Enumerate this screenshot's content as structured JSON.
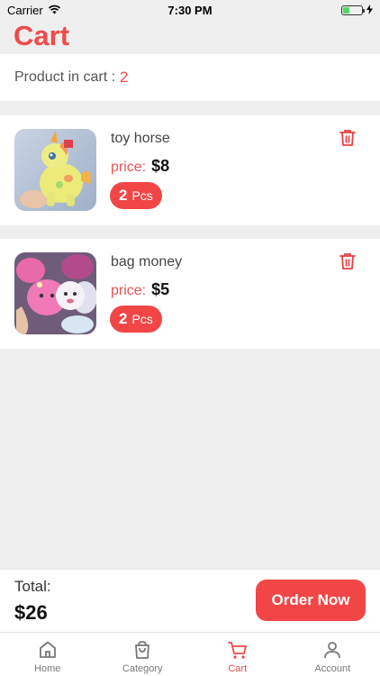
{
  "status_bar": {
    "carrier": "Carrier",
    "time": "7:30 PM",
    "battery_level": 0.35
  },
  "header": {
    "title": "Cart"
  },
  "cart_summary": {
    "label": "Product in cart :",
    "count": "2"
  },
  "items": [
    {
      "name": "toy horse",
      "price_label": "price:",
      "price": "$8",
      "qty": "2",
      "qty_unit": "Pcs",
      "image_icon": "toy-horse-photo"
    },
    {
      "name": "bag money",
      "price_label": "price:",
      "price": "$5",
      "qty": "2",
      "qty_unit": "Pcs",
      "image_icon": "bag-money-photo"
    }
  ],
  "footer": {
    "total_label": "Total:",
    "total_value": "$26",
    "order_button": "Order Now"
  },
  "tabs": [
    {
      "label": "Home",
      "icon": "home-icon",
      "active": false
    },
    {
      "label": "Category",
      "icon": "bag-icon",
      "active": false
    },
    {
      "label": "Cart",
      "icon": "cart-icon",
      "active": true
    },
    {
      "label": "Account",
      "icon": "user-icon",
      "active": false
    }
  ],
  "colors": {
    "accent": "#f24646",
    "title": "#f04a4a",
    "background": "#efefef"
  }
}
